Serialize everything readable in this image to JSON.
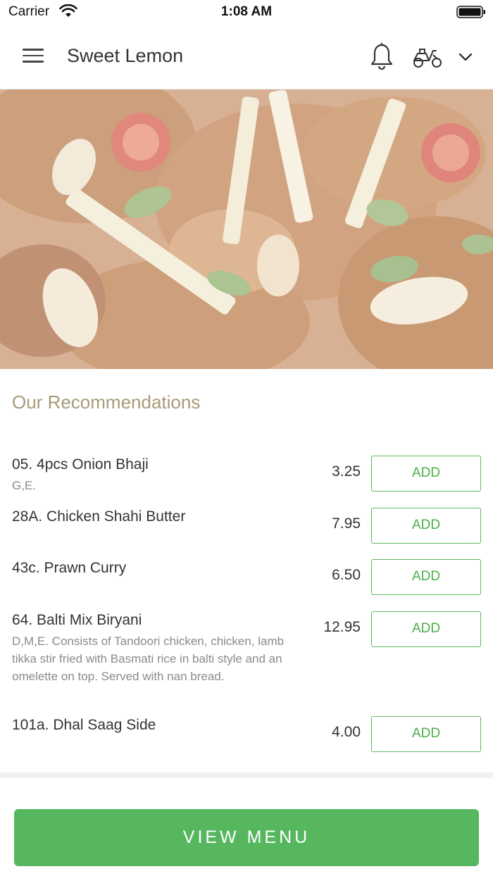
{
  "status_bar": {
    "carrier": "Carrier",
    "time": "1:08 AM"
  },
  "header": {
    "title": "Sweet Lemon",
    "menu_icon": "hamburger-icon",
    "notification_icon": "bell-icon",
    "delivery_icon": "scooter-icon",
    "dropdown_icon": "chevron-down-icon"
  },
  "recommendations": {
    "title": "Our Recommendations",
    "add_label": "ADD",
    "items": [
      {
        "name": "05. 4pcs Onion Bhaji",
        "desc": "G,E.",
        "price": "3.25"
      },
      {
        "name": "28A. Chicken Shahi Butter",
        "desc": "",
        "price": "7.95"
      },
      {
        "name": "43c. Prawn Curry",
        "desc": "",
        "price": "6.50"
      },
      {
        "name": "64. Balti Mix Biryani",
        "desc": "D,M,E. Consists of Tandoori chicken, chicken, lamb tikka stir fried with Basmati rice in balti style and an omelette on top. Served with nan bread.",
        "price": "12.95"
      },
      {
        "name": "101a. Dhal Saag Side",
        "desc": "",
        "price": "4.00"
      }
    ]
  },
  "footer": {
    "view_menu_label": "VIEW MENU"
  },
  "colors": {
    "accent_green": "#56b75f",
    "section_title": "#a89b78"
  }
}
